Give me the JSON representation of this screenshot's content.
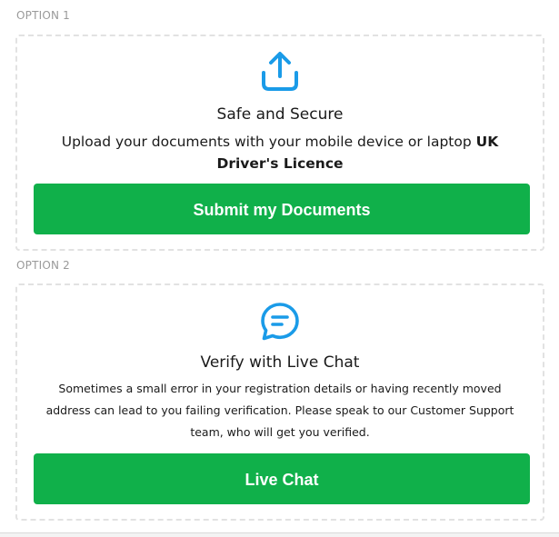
{
  "option1": {
    "label": "OPTION 1",
    "icon": "upload-icon",
    "title": "Safe and Secure",
    "desc_text": "Upload your documents with your mobile device or laptop ",
    "desc_bold": "UK Driver's Licence",
    "button_label": "Submit my Documents"
  },
  "option2": {
    "label": "OPTION 2",
    "icon": "chat-bubble-icon",
    "title": "Verify with Live Chat",
    "desc": "Sometimes a small error in your registration details or having recently moved address can lead to you failing verification. Please speak to our Customer Support team, who will get you verified.",
    "button_label": "Live Chat"
  },
  "colors": {
    "accent_blue": "#1a9be8",
    "button_green": "#10b04a",
    "dashed_border": "#e2e2e2",
    "label_gray": "#9a9a9a"
  }
}
